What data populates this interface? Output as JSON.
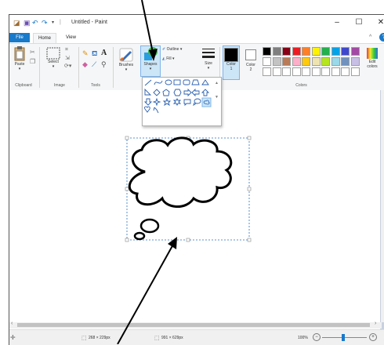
{
  "window": {
    "title": "Untitled - Paint",
    "minimize_glyph": "–",
    "maximize_glyph": "☐",
    "close_glyph": "✕"
  },
  "tabs": {
    "file": "File",
    "home": "Home",
    "view": "View"
  },
  "ribbon": {
    "paste": "Paste",
    "select": "Select",
    "brushes": "Brushes",
    "shapes": "Shapes",
    "outline": "Outline ▾",
    "fill": "Fill ▾",
    "size": "Size",
    "color1_line1": "Color",
    "color1_line2": "1",
    "color2_line1": "Color",
    "color2_line2": "2",
    "edit_colors_line1": "Edit",
    "edit_colors_line2": "colors",
    "groups": {
      "clipboard": "Clipboard",
      "image": "Image",
      "tools": "Tools",
      "colors": "Colors"
    },
    "palette_row1": [
      "#000000",
      "#7f7f7f",
      "#880015",
      "#ed1c24",
      "#ff7f27",
      "#fff200",
      "#22b14c",
      "#00a2e8",
      "#3f48cc",
      "#a349a4"
    ],
    "palette_row2": [
      "#ffffff",
      "#c3c3c3",
      "#b97a57",
      "#ffaec9",
      "#ffc90e",
      "#efe4b0",
      "#b5e61d",
      "#99d9ea",
      "#7092be",
      "#c8bfe7"
    ]
  },
  "status": {
    "selection_size": "268 × 229px",
    "canvas_size": "991 × 629px",
    "zoom": "100%"
  },
  "annotation": {
    "arrow_color": "#000000"
  }
}
